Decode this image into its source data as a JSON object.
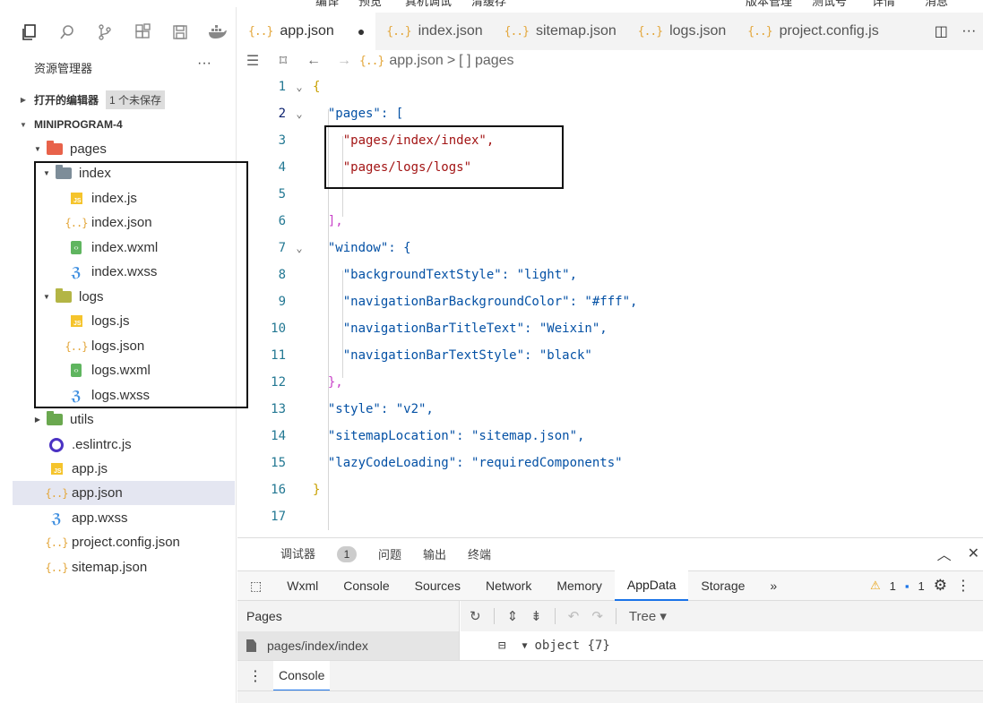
{
  "menu_top": {
    "items": [
      "编译",
      "预览",
      "真机调试",
      "清缓存",
      "版本管理",
      "测试号",
      "详情",
      "消息"
    ]
  },
  "activity_icons": [
    "files-icon",
    "search-icon",
    "source-control-icon",
    "extensions-icon",
    "save-icon",
    "docker-icon"
  ],
  "explorer": {
    "title": "资源管理器",
    "more": "···",
    "open_editors_label": "打开的编辑器",
    "unsaved_badge": "1 个未保存",
    "project_name": "MINIPROGRAM-4",
    "tree": [
      {
        "label": "pages",
        "type": "folder",
        "color": "#e8624a",
        "expanded": true
      },
      {
        "label": "index",
        "type": "folder",
        "color": "#7d8d99",
        "expanded": true
      },
      {
        "label": "index.js",
        "type": "js"
      },
      {
        "label": "index.json",
        "type": "json"
      },
      {
        "label": "index.wxml",
        "type": "wxml"
      },
      {
        "label": "index.wxss",
        "type": "wxss"
      },
      {
        "label": "logs",
        "type": "folder",
        "color": "#b3b545",
        "expanded": true
      },
      {
        "label": "logs.js",
        "type": "js"
      },
      {
        "label": "logs.json",
        "type": "json"
      },
      {
        "label": "logs.wxml",
        "type": "wxml"
      },
      {
        "label": "logs.wxss",
        "type": "wxss"
      },
      {
        "label": "utils",
        "type": "folder",
        "color": "#6aa84f",
        "expanded": false
      },
      {
        "label": ".eslintrc.js",
        "type": "eslint"
      },
      {
        "label": "app.js",
        "type": "js"
      },
      {
        "label": "app.json",
        "type": "json",
        "selected": true
      },
      {
        "label": "app.wxss",
        "type": "wxss"
      },
      {
        "label": "project.config.json",
        "type": "json"
      },
      {
        "label": "sitemap.json",
        "type": "json"
      }
    ]
  },
  "editor": {
    "tabs": [
      {
        "label": "app.json",
        "active": true,
        "dirty_mark": "●"
      },
      {
        "label": "index.json"
      },
      {
        "label": "sitemap.json"
      },
      {
        "label": "logs.json"
      },
      {
        "label": "project.config.js"
      }
    ],
    "tab_actions": {
      "split": "◫",
      "more": "···"
    },
    "breadcrumb": {
      "file": "app.json",
      "sep": ">",
      "node": "[ ] pages"
    },
    "lines": [
      {
        "n": "1",
        "text": "{"
      },
      {
        "n": "2",
        "text": "  \"pages\": ["
      },
      {
        "n": "3",
        "text": "    \"pages/index/index\","
      },
      {
        "n": "4",
        "text": "    \"pages/logs/logs\""
      },
      {
        "n": "5",
        "text": ""
      },
      {
        "n": "6",
        "text": "  ],"
      },
      {
        "n": "7",
        "text": "  \"window\": {"
      },
      {
        "n": "8",
        "text": "    \"backgroundTextStyle\": \"light\","
      },
      {
        "n": "9",
        "text": "    \"navigationBarBackgroundColor\": \"#fff\","
      },
      {
        "n": "10",
        "text": "    \"navigationBarTitleText\": \"Weixin\","
      },
      {
        "n": "11",
        "text": "    \"navigationBarTextStyle\": \"black\""
      },
      {
        "n": "12",
        "text": "  },"
      },
      {
        "n": "13",
        "text": "  \"style\": \"v2\","
      },
      {
        "n": "14",
        "text": "  \"sitemapLocation\": \"sitemap.json\","
      },
      {
        "n": "15",
        "text": "  \"lazyCodeLoading\": \"requiredComponents\""
      },
      {
        "n": "16",
        "text": "}"
      },
      {
        "n": "17",
        "text": ""
      }
    ]
  },
  "devtools": {
    "top_tabs": [
      "调试器",
      "问题",
      "输出",
      "终端"
    ],
    "debugger_count": "1",
    "panel_tabs": [
      "Wxml",
      "Console",
      "Sources",
      "Network",
      "Memory",
      "AppData",
      "Storage"
    ],
    "active_panel": "AppData",
    "overflow": "»",
    "warnings": "1",
    "infos": "1",
    "pages_header": "Pages",
    "pages_item": "pages/index/index",
    "tree_mode": "Tree",
    "object_label": "object {7}",
    "console_tab": "Console"
  }
}
